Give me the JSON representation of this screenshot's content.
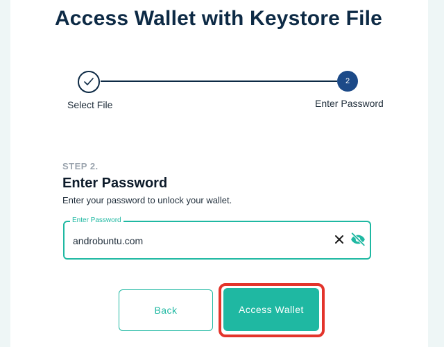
{
  "page": {
    "title": "Access Wallet with Keystore File"
  },
  "stepper": {
    "steps": [
      {
        "label": "Select File",
        "state": "complete",
        "icon": "check-icon"
      },
      {
        "label": "Enter Password",
        "state": "active",
        "number": "2"
      }
    ]
  },
  "step_section": {
    "kicker": "STEP 2.",
    "heading": "Enter Password",
    "description": "Enter your password to unlock your wallet."
  },
  "password_field": {
    "label": "Enter Password",
    "value": "androbuntu.com",
    "clear_icon": "close-icon",
    "visibility_icon": "eye-off-icon"
  },
  "actions": {
    "back_label": "Back",
    "access_label": "Access Wallet"
  },
  "colors": {
    "primary": "#1fb8a2",
    "navy": "#0d2a45",
    "step_active": "#1c4a88",
    "highlight": "#e3342b"
  }
}
